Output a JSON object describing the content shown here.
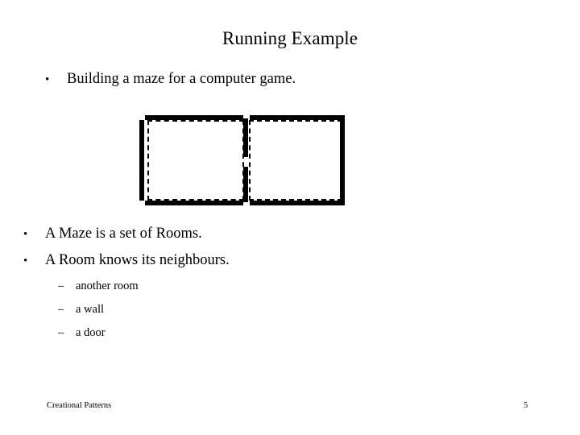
{
  "slide": {
    "title": "Running Example",
    "intro_bullet": {
      "marker": "•",
      "text": "Building a maze for a computer game."
    },
    "statements": [
      {
        "marker": "•",
        "text": "A Maze is a set of Rooms."
      },
      {
        "marker": "•",
        "text": "A Room knows its neighbours."
      }
    ],
    "neighbour_kinds": [
      {
        "marker": "–",
        "text": "another room"
      },
      {
        "marker": "–",
        "text": "a wall"
      },
      {
        "marker": "–",
        "text": "a door"
      }
    ],
    "diagram": {
      "name": "two-room-maze",
      "description": "Two adjacent rooms drawn with thick solid walls and dashed interiors, sharing a middle wall with a door gap",
      "rooms": [
        {
          "label": "room-one"
        },
        {
          "label": "room-two"
        }
      ],
      "wall_color": "#000000",
      "interior_border_style": "dashed"
    },
    "footer": {
      "label": "Creational Patterns",
      "page_number": "5"
    }
  }
}
